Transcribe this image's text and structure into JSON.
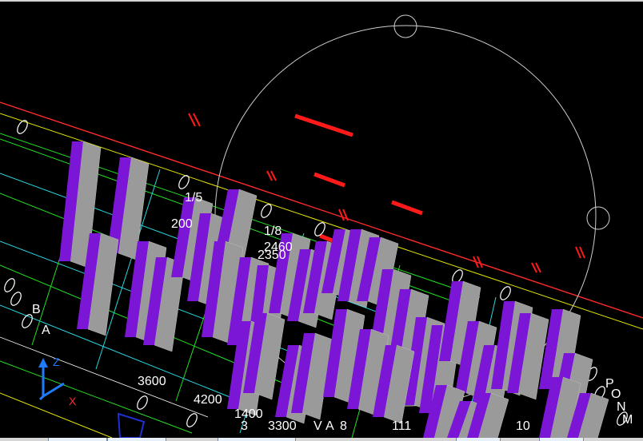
{
  "viewport": {
    "background": "#000000",
    "colors": {
      "column_side": "#7b16d6",
      "column_face": "#9a9a9a",
      "beam_red": "#ff0000",
      "line_green": "#22e022",
      "line_cyan": "#27d7e0",
      "line_yellow": "#e6e600",
      "orbit": "#cfcfcf"
    },
    "dimensions": [
      "3600",
      "4200",
      "1400",
      "3300",
      "2460",
      "2350",
      "200"
    ],
    "grid_letters": [
      "B",
      "A",
      "P",
      "O",
      "N",
      "M"
    ],
    "misc_labels": [
      "8",
      "1/5",
      "1/8",
      "111",
      "10",
      "V",
      "A",
      "3"
    ],
    "axis": {
      "z": "Z",
      "x": "X",
      "icon": "ucs-axis-icon"
    },
    "orbit_icon": "orbit-circle-icon"
  },
  "statusbar": {
    "tabs": [
      "",
      "",
      "",
      "",
      ""
    ]
  }
}
